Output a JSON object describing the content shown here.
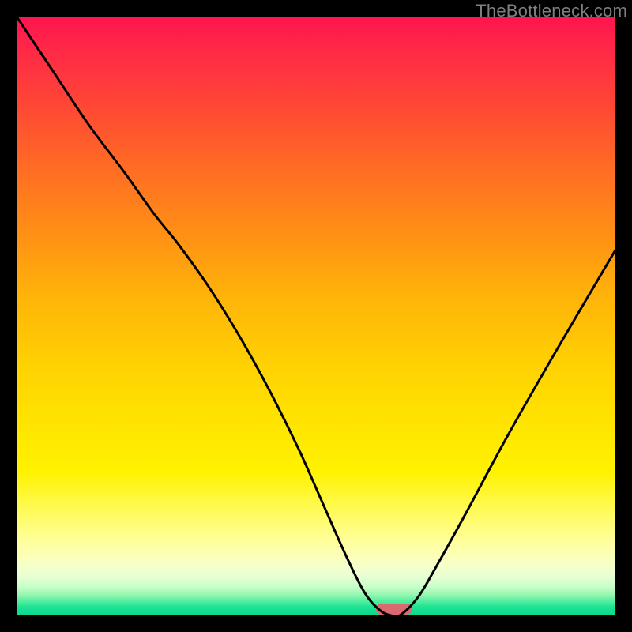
{
  "watermark": "TheBottleneck.com",
  "chart_data": {
    "type": "line",
    "title": "",
    "xlabel": "",
    "ylabel": "",
    "xlim": [
      0,
      100
    ],
    "ylim": [
      0,
      100
    ],
    "grid": false,
    "legend": false,
    "series": [
      {
        "name": "bottleneck-curve",
        "x": [
          0,
          6,
          12,
          18,
          23,
          27,
          32,
          37,
          42,
          47,
          51,
          55,
          58,
          60.5,
          62.5,
          64,
          67,
          70,
          75,
          82,
          90,
          100
        ],
        "values": [
          100,
          91,
          82,
          74,
          67,
          62,
          55,
          47,
          38,
          28,
          19,
          10,
          4,
          1,
          0,
          0,
          3,
          8,
          17,
          30,
          44,
          61
        ]
      }
    ],
    "marker": {
      "name": "optimal-marker",
      "x_center": 63,
      "width": 6,
      "color": "#d96a6f"
    },
    "gradient_stops": [
      {
        "pos": 0,
        "color": "#ff1450"
      },
      {
        "pos": 0.5,
        "color": "#ffb800"
      },
      {
        "pos": 0.8,
        "color": "#fff200"
      },
      {
        "pos": 0.93,
        "color": "#f0ffd0"
      },
      {
        "pos": 1.0,
        "color": "#0ad88e"
      }
    ]
  }
}
